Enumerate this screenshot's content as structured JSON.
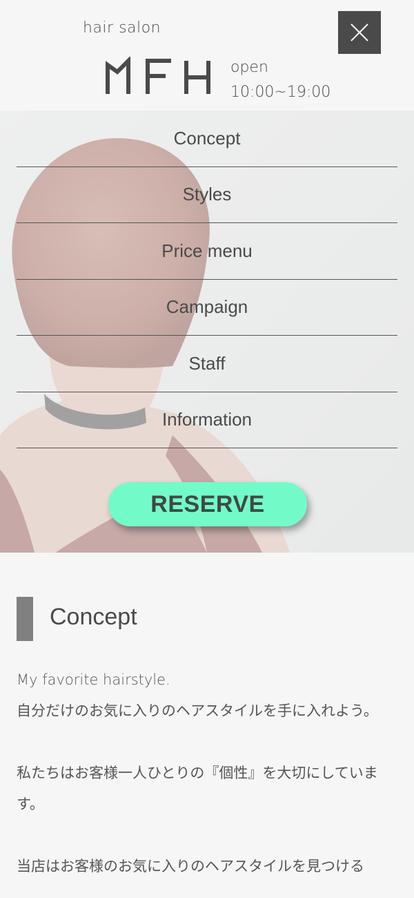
{
  "header": {
    "tagline": "hair salon",
    "logo_text": "MFH",
    "hours_label": "open",
    "hours_value": "10:00~19:00",
    "close_icon": "close-icon"
  },
  "menu": {
    "items": [
      {
        "label": "Concept"
      },
      {
        "label": "Styles"
      },
      {
        "label": "Price menu"
      },
      {
        "label": "Campaign"
      },
      {
        "label": "Staff"
      },
      {
        "label": "Information"
      }
    ],
    "reserve_label": "RESERVE",
    "reserve_color": "#72fbc9"
  },
  "concept": {
    "title": "Concept",
    "paragraphs": [
      "My favorite hairstyle.",
      "自分だけのお気に入りのヘアスタイルを手に入れよう。",
      "私たちはお客様一人ひとりの『個性』を大切にしています。",
      "当店はお客様のお気に入りのヘアスタイルを見つける"
    ]
  },
  "colors": {
    "background": "#f6f6f6",
    "text": "#4a4a4a",
    "close_button": "#4a4a4a",
    "accent": "#72fbc9",
    "marker": "#808080"
  }
}
